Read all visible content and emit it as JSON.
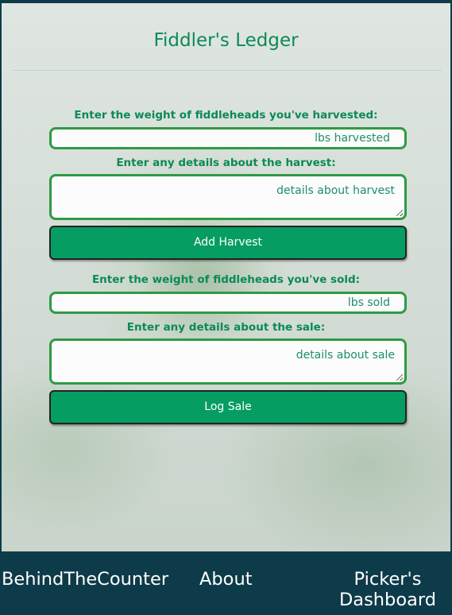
{
  "app": {
    "title": "Fiddler's Ledger"
  },
  "harvest": {
    "weight_label": "Enter the weight of fiddleheads you've harvested:",
    "weight_placeholder": "lbs harvested",
    "details_label": "Enter any details about the harvest:",
    "details_placeholder": "details about harvest",
    "button_label": "Add Harvest"
  },
  "sale": {
    "weight_label": "Enter the weight of fiddleheads you've sold:",
    "weight_placeholder": "lbs sold",
    "details_label": "Enter any details about the sale:",
    "details_placeholder": "details about sale",
    "button_label": "Log Sale"
  },
  "footer": {
    "links": [
      "BehindTheCounter",
      "About",
      "Picker's Dashboard"
    ]
  },
  "colors": {
    "accent": "#069d63",
    "title": "#0b8a55",
    "footer_bg": "#0e3b49"
  }
}
